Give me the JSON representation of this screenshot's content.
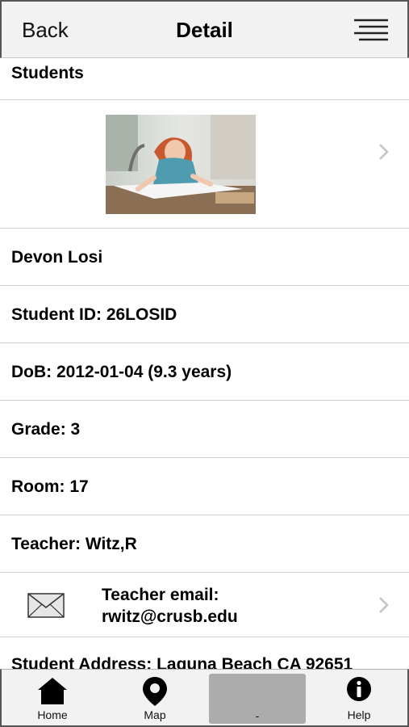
{
  "nav": {
    "back_label": "Back",
    "title": "Detail",
    "menu_icon": "hamburger-menu-icon"
  },
  "section": {
    "title": "Students"
  },
  "student": {
    "photo_icon": "student-photo",
    "name": "Devon Losi",
    "student_id": "Student ID: 26LOSID",
    "dob": "DoB: 2012-01-04 (9.3 years)",
    "grade": "Grade: 3",
    "room": "Room: 17",
    "teacher": "Teacher: Witz,R",
    "teacher_email_label": "Teacher email:",
    "teacher_email": "rwitz@crusb.edu",
    "address": "Student Address:  Laguna Beach CA 92651"
  },
  "tabbar": {
    "items": [
      {
        "label": "Home",
        "icon": "home-icon"
      },
      {
        "label": "Map",
        "icon": "map-pin-icon"
      },
      {
        "label": "-",
        "icon": ""
      },
      {
        "label": "Help",
        "icon": "info-icon"
      }
    ]
  },
  "colors": {
    "bar_background": "#f2f2f2",
    "separator": "#d0d0d0",
    "chevron": "#c4c4c4",
    "blank_tab": "#acacac"
  }
}
